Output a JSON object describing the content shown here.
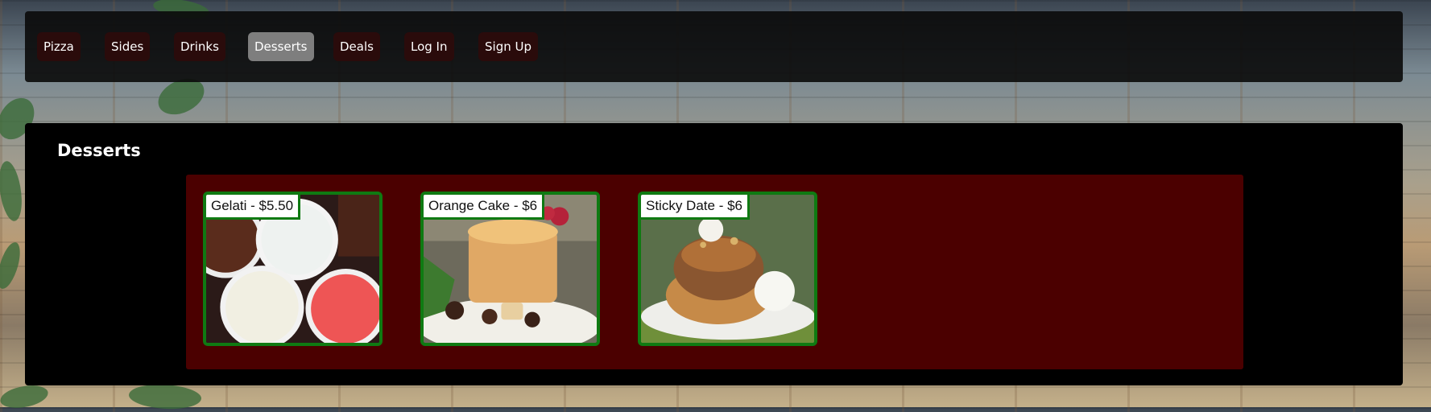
{
  "nav": {
    "items": [
      {
        "label": "Pizza"
      },
      {
        "label": "Sides"
      },
      {
        "label": "Drinks"
      },
      {
        "label": "Desserts",
        "active": true
      },
      {
        "label": "Deals"
      },
      {
        "label": "Log In"
      },
      {
        "label": "Sign Up"
      }
    ]
  },
  "section": {
    "title": "Desserts",
    "items": [
      {
        "label": "Gelati - $5.50"
      },
      {
        "label": "Orange Cake - $6"
      },
      {
        "label": "Sticky Date - $6"
      }
    ]
  },
  "colors": {
    "card_border": "#0f7a12",
    "grid_background": "#4b0000",
    "active_nav": "#7e7e7e"
  }
}
